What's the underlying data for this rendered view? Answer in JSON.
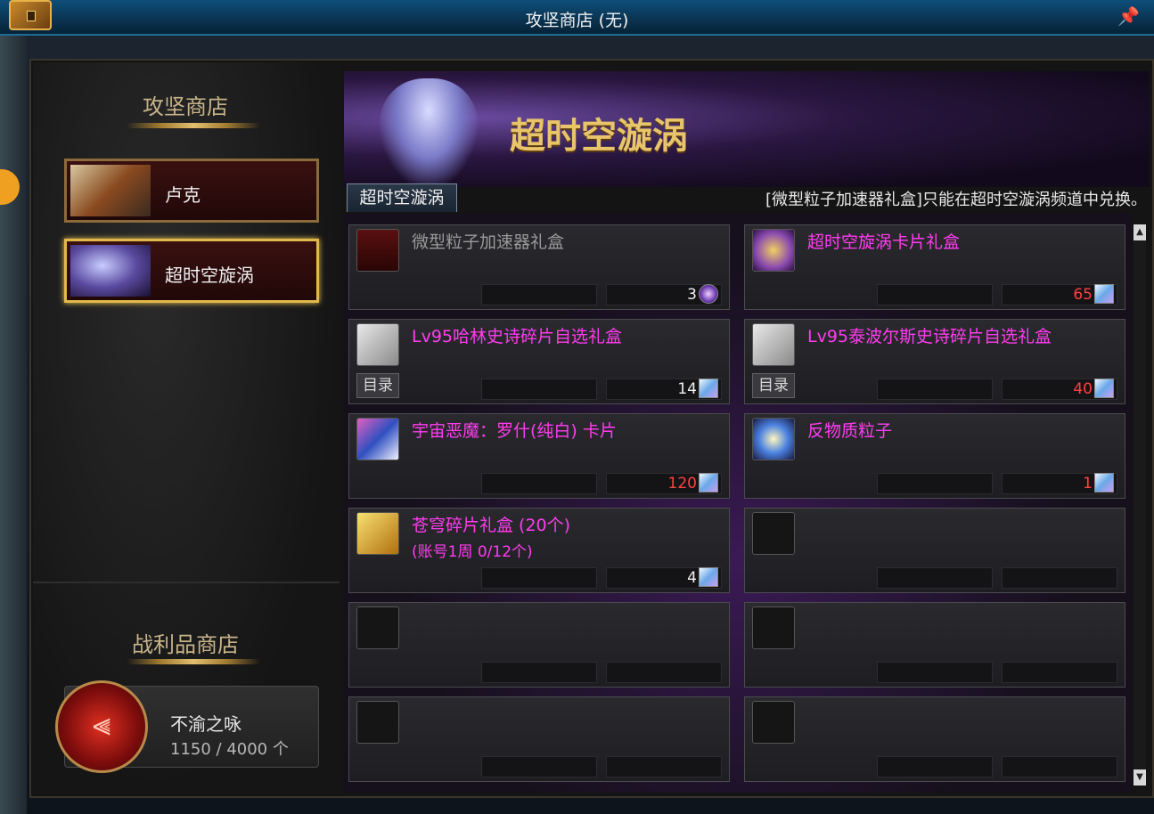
{
  "window": {
    "title": "攻坚商店 (无)"
  },
  "left_panel": {
    "section_title": "攻坚商店",
    "npcs": [
      {
        "label": "卢克",
        "active": false
      },
      {
        "label": "超时空旋涡",
        "active": true
      }
    ],
    "loot_shop": {
      "title": "战利品商店",
      "currency_name": "不渝之咏",
      "currency_count": "1150 / 4000 个"
    }
  },
  "shop": {
    "banner_title": "超时空漩涡",
    "tab_label": "超时空漩涡",
    "notice": "[微型粒子加速器礼盒]只能在超时空漩涡频道中兑换。",
    "catalog_label": "目录",
    "items": [
      {
        "name": "微型粒子加速器礼盒",
        "price": "3",
        "enabled": false,
        "price_red": false,
        "currency": "orb",
        "icon": "red-gift-box-icon"
      },
      {
        "name": "超时空旋涡卡片礼盒",
        "price": "65",
        "enabled": true,
        "price_red": true,
        "currency": "crystal",
        "icon": "purple-card-box-icon"
      },
      {
        "name": "Lv95哈林史诗碎片自选礼盒",
        "price": "14",
        "enabled": true,
        "price_red": false,
        "currency": "crystal",
        "icon": "epic-fragment-box-icon",
        "catalog": true
      },
      {
        "name": "Lv95泰波尔斯史诗碎片自选礼盒",
        "price": "40",
        "enabled": true,
        "price_red": true,
        "currency": "crystal",
        "icon": "epic-fragment-box-icon",
        "catalog": true
      },
      {
        "name": "宇宙恶魔：罗什(纯白) 卡片",
        "price": "120",
        "enabled": true,
        "price_red": true,
        "currency": "crystal",
        "icon": "card-icon"
      },
      {
        "name": "反物质粒子",
        "price": "1",
        "enabled": true,
        "price_red": true,
        "currency": "crystal",
        "icon": "antimatter-particle-icon"
      },
      {
        "name": "苍穹碎片礼盒 (20个)",
        "sub": "(账号1周 0/12个)",
        "price": "4",
        "enabled": true,
        "price_red": false,
        "currency": "crystal",
        "icon": "golden-chest-icon"
      }
    ]
  }
}
